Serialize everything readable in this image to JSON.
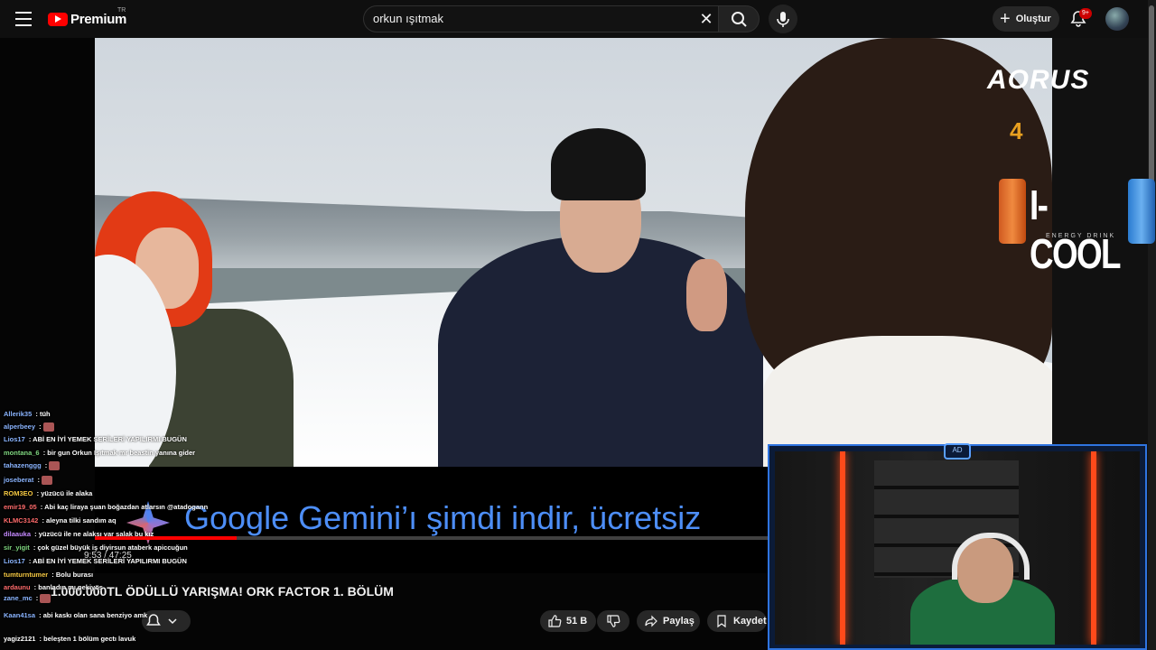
{
  "header": {
    "brand": "Premium",
    "region": "TR",
    "search_value": "orkun ışıtmak",
    "create_label": "Oluştur",
    "notification_count": "9+"
  },
  "video": {
    "sponsor_logo": "AORUS",
    "sponsor_drink": "I-COOL",
    "sponsor_drink_sub": "ENERGY DRINK",
    "ad_text": "Google Gemini’ı şimdi indir, ücretsiz",
    "time": "9:53 / 47:25",
    "progress": 0.209,
    "title": "1.000.000TL ÖDÜLLÜ YARIŞMA! ORK FACTOR 1. BÖLÜM"
  },
  "actions": {
    "likes": "51 B",
    "share_label": "Paylaş",
    "save_label": "Kaydet"
  },
  "chat": [
    {
      "user": "Allerik35",
      "msg": "tüh",
      "color": "#8ab4ff"
    },
    {
      "user": "alperbeey",
      "msg": "",
      "color": "#8ab4ff"
    },
    {
      "user": "Lios17",
      "msg": "ABİ EN İYİ YEMEK SERİLERİ YAPILIRMI BUGÜN",
      "color": "#8ab4ff"
    },
    {
      "user": "montana_6",
      "msg": "bir gun Orkun Işıtmak mr beastin yanına gider",
      "color": "#7fd67f"
    },
    {
      "user": "tahazenggg",
      "msg": "",
      "color": "#8ab4ff"
    },
    {
      "user": "joseberat",
      "msg": "",
      "color": "#8ab4ff"
    },
    {
      "user": "ROM3EO",
      "msg": "yüzücü ile alaka",
      "color": "#f5c842"
    },
    {
      "user": "emir19_05",
      "msg": "Abi kaç liraya şuan boğazdan atlarsın @atadogann",
      "color": "#ff6b6b"
    },
    {
      "user": "KLMC3142",
      "msg": "aleyna tilki sandım aq",
      "color": "#ff6b6b"
    },
    {
      "user": "dilaauka",
      "msg": "yüzücü ile ne alaksı var salak bu kız",
      "color": "#c58aff"
    },
    {
      "user": "sir_yigit",
      "msg": "çok güzel büyük iş diyirsun ataberk apiccuğun",
      "color": "#7fd67f"
    },
    {
      "user": "Lios17",
      "msg": "ABİ EN İYİ YEMEK SERİLERİ YAPILIRMI BUGÜN",
      "color": "#8ab4ff"
    },
    {
      "user": "tumturntumer",
      "msg": "Bolu burası",
      "color": "#f5c842"
    },
    {
      "user": "zane_mc",
      "msg": "",
      "color": "#8ab4ff"
    },
    {
      "user": "ardaunu",
      "msg": "banladın mı pekiyöş",
      "color": "#ff6b6b"
    },
    {
      "user": "Kaan41sa",
      "msg": "abi kaskı olan sana benziyo amk",
      "color": "#8ab4ff"
    },
    {
      "user": "yagiz2121",
      "msg": "beleşten 1 bölüm gectı lavuk",
      "color": "#ffffff"
    }
  ],
  "colors": {
    "accent": "#ff0000",
    "background": "#0f0f0f",
    "pill": "#272727",
    "gemini_blue": "#4d8ef7",
    "cam_frame": "#2f74e0"
  },
  "icons": [
    "menu-icon",
    "youtube-logo-icon",
    "close-icon",
    "search-icon",
    "mic-icon",
    "plus-icon",
    "bell-icon",
    "like-icon",
    "dislike-icon",
    "share-icon",
    "save-icon",
    "chevron-down-icon"
  ]
}
